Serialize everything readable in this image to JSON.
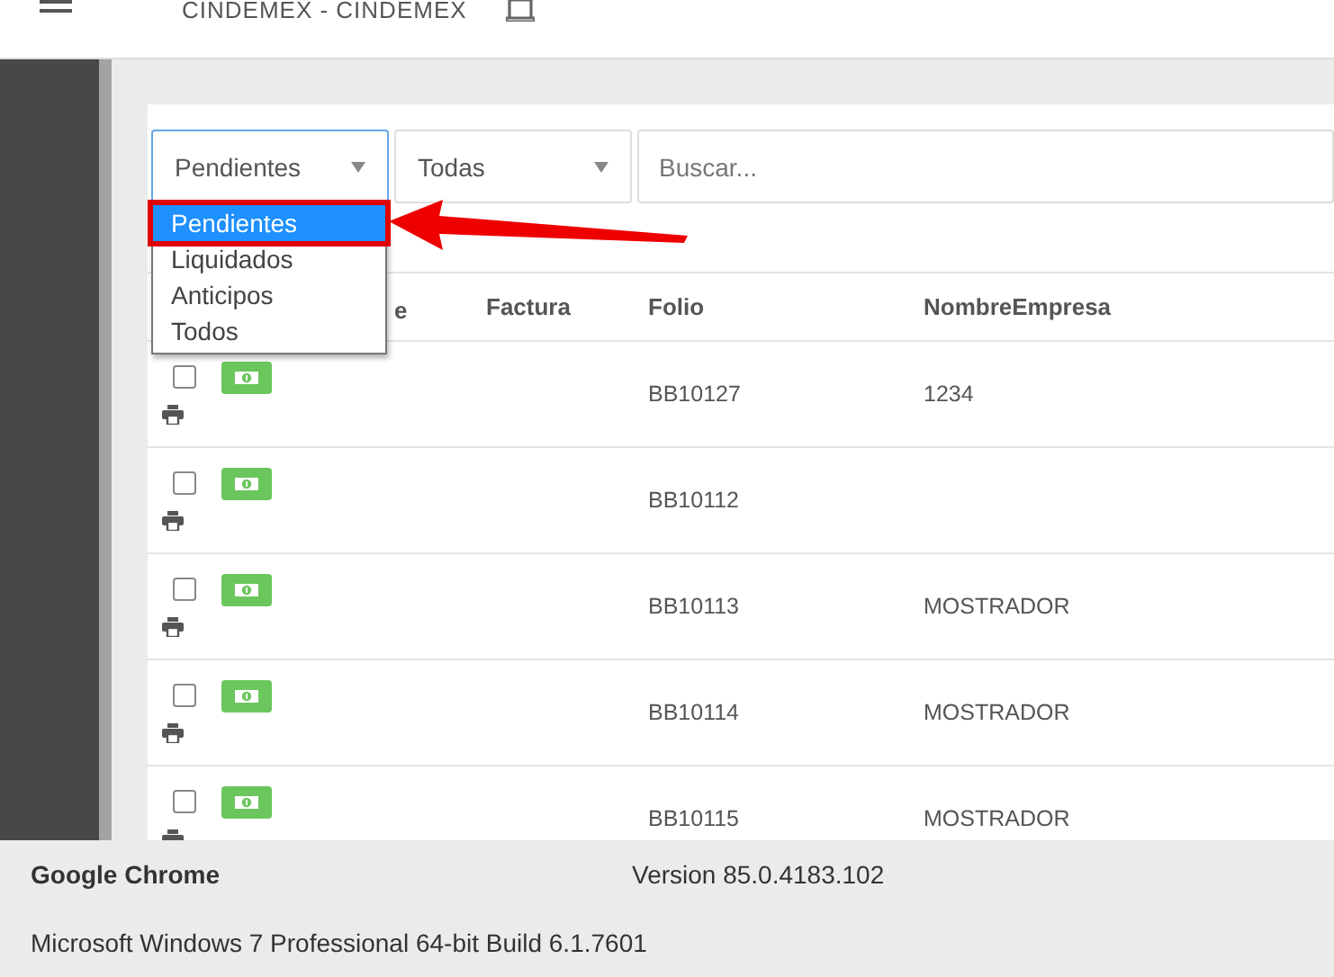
{
  "header": {
    "title": "CINDEMEX - CINDEMEX"
  },
  "filters": {
    "status_select": {
      "value": "Pendientes",
      "expanded": true,
      "options": [
        {
          "label": "Pendientes",
          "selected": true
        },
        {
          "label": "Liquidados",
          "selected": false
        },
        {
          "label": "Anticipos",
          "selected": false
        },
        {
          "label": "Todos",
          "selected": false
        }
      ]
    },
    "type_select": {
      "value": "Todas"
    },
    "search": {
      "placeholder": "Buscar..."
    }
  },
  "table": {
    "columns": [
      {
        "label": "e"
      },
      {
        "label": "Factura"
      },
      {
        "label": "Folio"
      },
      {
        "label": "NombreEmpresa"
      }
    ],
    "rows": [
      {
        "checked": false,
        "factura": "",
        "folio": "BB10127",
        "empresa": "1234"
      },
      {
        "checked": false,
        "factura": "",
        "folio": "BB10112",
        "empresa": ""
      },
      {
        "checked": false,
        "factura": "",
        "folio": "BB10113",
        "empresa": "MOSTRADOR"
      },
      {
        "checked": false,
        "factura": "",
        "folio": "BB10114",
        "empresa": "MOSTRADOR"
      },
      {
        "checked": false,
        "factura": "",
        "folio": "BB10115",
        "empresa": "MOSTRADOR"
      }
    ]
  },
  "about": {
    "product": "Google Chrome",
    "version": "Version 85.0.4183.102",
    "os": "Microsoft Windows 7 Professional  64-bit Build 6.1.7601"
  }
}
